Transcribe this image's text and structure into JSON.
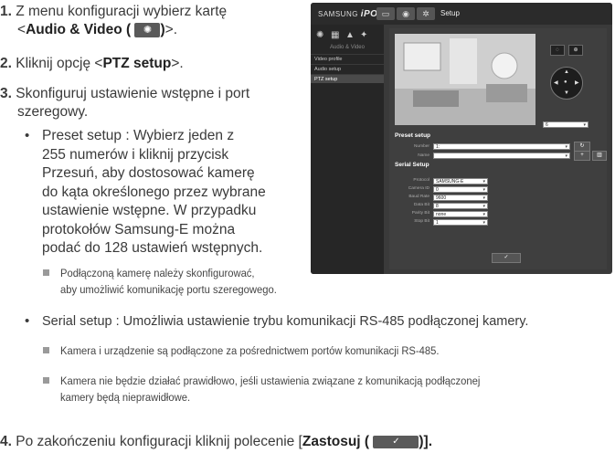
{
  "steps": {
    "s1_num": "1.",
    "s1_a": "Z menu konfiguracji wybierz kartę",
    "s1_b_pre": "<",
    "s1_b_bold": "Audio & Video (",
    "s1_b_icon": "✺",
    "s1_b_bold2": ")",
    "s1_b_post": ">.",
    "s2_num": "2.",
    "s2_pre": "Kliknij opcję <",
    "s2_bold": "PTZ setup",
    "s2_post": ">.",
    "s3_num": "3.",
    "s3_a": "Skonfiguruj ustawienie wstępne i port",
    "s3_b": "szeregowy.",
    "bullet1": [
      "Preset setup : Wybierz jeden z",
      "255 numerów i kliknij przycisk",
      "Przesuń, aby dostosować kamerę",
      "do kąta określonego przez wybrane",
      "ustawienie wstępne. W przypadku",
      "protokołów Samsung-E można",
      "podać do 128 ustawień wstępnych."
    ],
    "note1": [
      "Podłączoną kamerę należy skonfigurować,",
      "aby umożliwić komunikację portu szeregowego."
    ],
    "bullet2": "Serial setup : Umożliwia ustawienie trybu komunikacji RS-485 podłączonej kamery.",
    "note2": "Kamera i urządzenie są podłączone za pośrednictwem portów komunikacji RS-485.",
    "note3": [
      "Kamera nie będzie działać prawidłowo, jeśli ustawienia związane z komunikacją podłączonej",
      "kamery będą nieprawidłowe."
    ],
    "s4_num": "4.",
    "s4_pre": "Po zakończeniu konfiguracji kliknij polecenie [",
    "s4_bold": "Zastosuj (",
    "s4_btn": "✓",
    "s4_post": ")]."
  },
  "screenshot": {
    "logo_a": "SAMSUNG",
    "logo_b": "iPOLiS",
    "setup": "Setup",
    "side_category": "Audio & Video",
    "side_items": [
      "Video profile",
      "Audio setup",
      "PTZ setup"
    ],
    "preset_title": "Preset setup",
    "number_label": "Number",
    "number_value": "1:",
    "name_label": "Name",
    "serial_title": "Serial Setup",
    "fields": [
      {
        "label": "Protocol",
        "value": "SAMSUNG-E"
      },
      {
        "label": "Camera ID",
        "value": "0"
      },
      {
        "label": "Baud Rate",
        "value": "9600"
      },
      {
        "label": "Data Bit",
        "value": "8"
      },
      {
        "label": "Parity Bit",
        "value": "none"
      },
      {
        "label": "Stop Bit",
        "value": "1"
      }
    ],
    "ptz_select": "6",
    "apply": "✓"
  }
}
